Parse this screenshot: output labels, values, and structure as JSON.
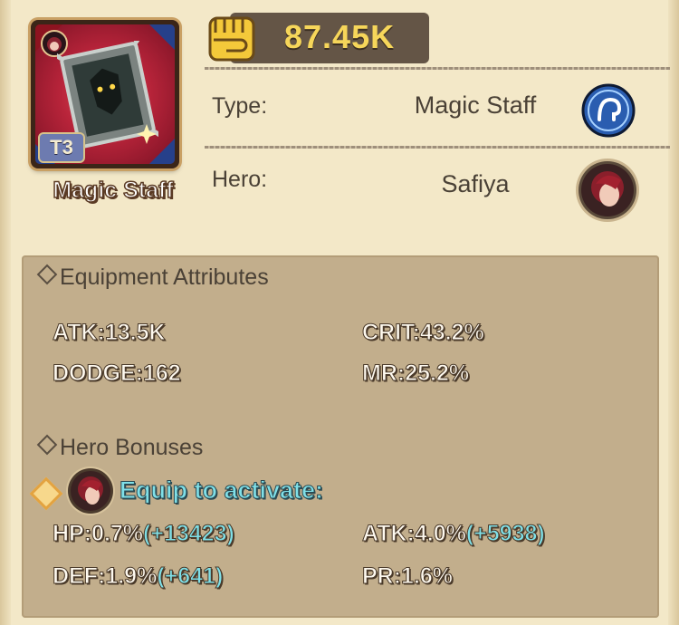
{
  "item": {
    "name": "Magic Staff",
    "tier": "T3",
    "icon": "magic-staff-item-icon",
    "rarity_color": "#b8243a"
  },
  "power": {
    "value": "87.45K",
    "icon": "fist-icon",
    "color": "#f6d65a"
  },
  "info": {
    "type_label": "Type:",
    "type_value": "Magic Staff",
    "type_icon": "mage-class-icon",
    "hero_label": "Hero:",
    "hero_value": "Safiya",
    "hero_icon": "hero-portrait"
  },
  "equipment": {
    "title": "Equipment Attributes",
    "stats": [
      {
        "text": "ATK:13.5K"
      },
      {
        "text": "CRIT:43.2%"
      },
      {
        "text": "DODGE:162"
      },
      {
        "text": "MR:25.2%"
      }
    ]
  },
  "hero_bonuses": {
    "title": "Hero Bonuses",
    "activate_text": "Equip to activate:",
    "stats": [
      {
        "text": "HP:0.7%",
        "bonus": "(+13423)"
      },
      {
        "text": "ATK:4.0%",
        "bonus": "(+5938)"
      },
      {
        "text": "DEF:1.9%",
        "bonus": "(+641)"
      },
      {
        "text": "PR:1.6%",
        "bonus": ""
      }
    ]
  }
}
